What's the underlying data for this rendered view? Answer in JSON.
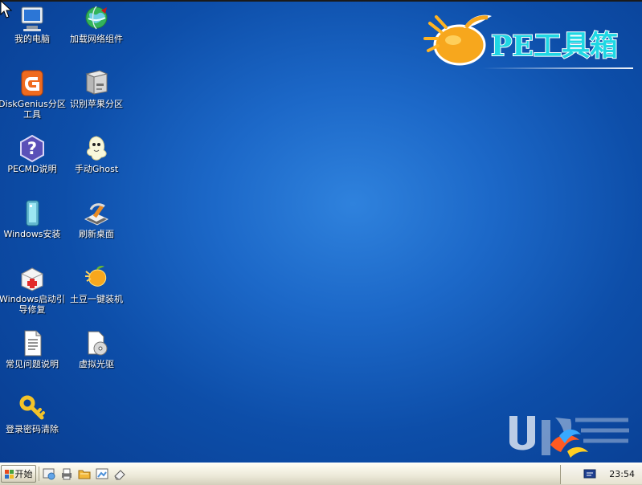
{
  "desktop": {
    "brand_text": "PE工具箱",
    "icons": [
      {
        "label": "我的电脑",
        "icon": "computer-icon"
      },
      {
        "label": "加载网络组件",
        "icon": "network-globe-icon"
      },
      {
        "label": "DiskGenius分区工具",
        "icon": "diskgenius-icon"
      },
      {
        "label": "识别苹果分区",
        "icon": "drive-icon"
      },
      {
        "label": "PECMD说明",
        "icon": "help-icon"
      },
      {
        "label": "手动Ghost",
        "icon": "ghost-icon"
      },
      {
        "label": "Windows安装",
        "icon": "windows-install-icon"
      },
      {
        "label": "刷新桌面",
        "icon": "refresh-desktop-icon"
      },
      {
        "label": "Windows启动引导修复",
        "icon": "boot-repair-icon"
      },
      {
        "label": "土豆一键装机",
        "icon": "potato-install-icon"
      },
      {
        "label": "常见问题说明",
        "icon": "document-icon"
      },
      {
        "label": "虚拟光驱",
        "icon": "virtual-drive-icon"
      },
      {
        "label": "登录密码清除",
        "icon": "key-icon"
      }
    ]
  },
  "taskbar": {
    "start_label": "开始",
    "clock": "23:54"
  },
  "colors": {
    "desktop_blue": "#1c68c8",
    "taskbar": "#ece9d8",
    "logo_cyan": "#1fd7e4",
    "logo_orange": "#f6a11d"
  }
}
